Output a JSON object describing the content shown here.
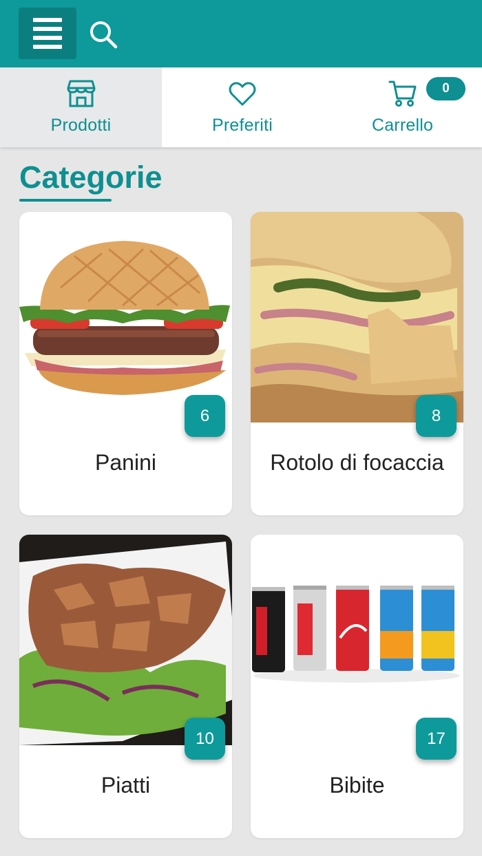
{
  "header": {
    "menu_icon": "hamburger-menu-icon",
    "search_icon": "search-icon",
    "colors": {
      "primary": "#0e9a9a",
      "menu_button": "#0b7f80"
    }
  },
  "tabs": [
    {
      "label": "Prodotti",
      "icon": "store-icon",
      "active": true
    },
    {
      "label": "Preferiti",
      "icon": "heart-icon",
      "active": false
    },
    {
      "label": "Carrello",
      "icon": "cart-icon",
      "active": false,
      "badge": "0"
    }
  ],
  "section": {
    "title": "Categorie"
  },
  "categories": [
    {
      "name": "Panini",
      "count": "6",
      "image": "burger"
    },
    {
      "name": "Rotolo di focaccia",
      "count": "8",
      "image": "focaccia-roll"
    },
    {
      "name": "Piatti",
      "count": "10",
      "image": "kebab-plate"
    },
    {
      "name": "Bibite",
      "count": "17",
      "image": "soda-cans"
    }
  ]
}
